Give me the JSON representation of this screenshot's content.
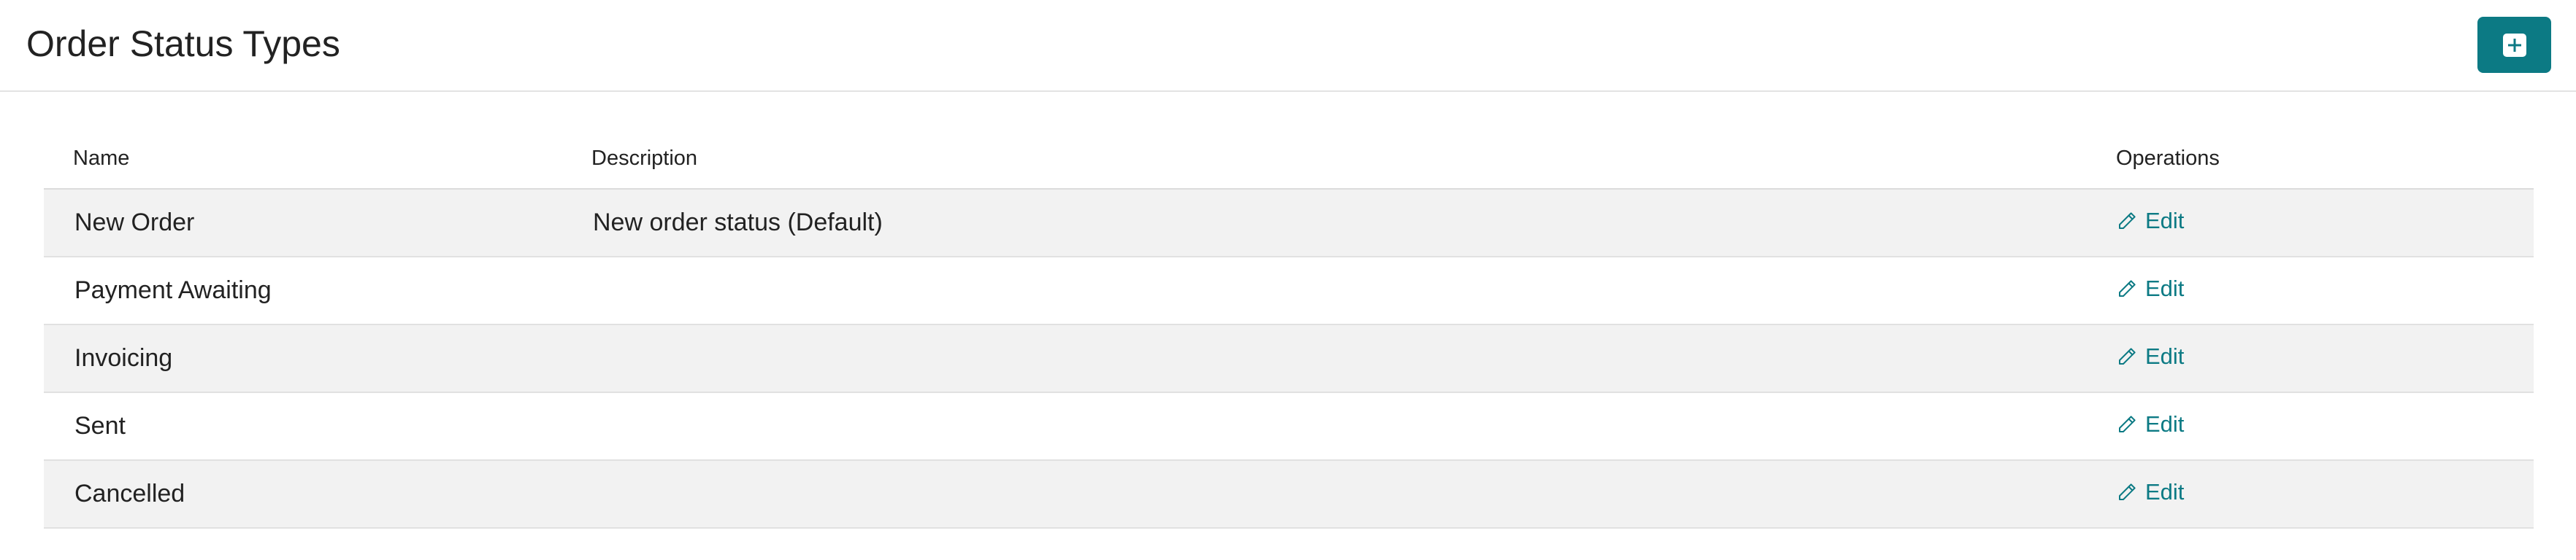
{
  "header": {
    "title": "Order Status Types",
    "add_button_icon": "plus-square-icon"
  },
  "colors": {
    "accent": "#0c7a84",
    "row_alt": "#f2f2f2",
    "text": "#222222"
  },
  "table": {
    "columns": [
      "Name",
      "Description",
      "Operations"
    ],
    "rows": [
      {
        "name": "New Order",
        "description": "New order status (Default)",
        "operation": "Edit",
        "operation_icon": "pencil-icon"
      },
      {
        "name": "Payment Awaiting",
        "description": "",
        "operation": "Edit",
        "operation_icon": "pencil-icon"
      },
      {
        "name": "Invoicing",
        "description": "",
        "operation": "Edit",
        "operation_icon": "pencil-icon"
      },
      {
        "name": "Sent",
        "description": "",
        "operation": "Edit",
        "operation_icon": "pencil-icon"
      },
      {
        "name": "Cancelled",
        "description": "",
        "operation": "Edit",
        "operation_icon": "pencil-icon"
      }
    ]
  }
}
